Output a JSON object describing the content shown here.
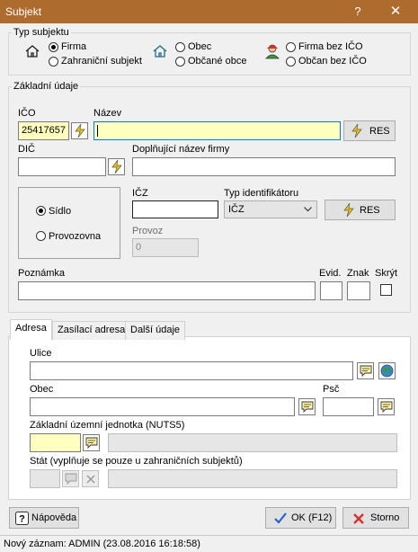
{
  "window": {
    "title": "Subjekt",
    "help": "?",
    "close": "✕"
  },
  "typ_subjektu": {
    "label": "Typ subjektu",
    "options": [
      {
        "label": "Firma",
        "selected": true
      },
      {
        "label": "Zahraniční subjekt",
        "selected": false
      },
      {
        "label": "Obec",
        "selected": false
      },
      {
        "label": "Občané obce",
        "selected": false
      },
      {
        "label": "Firma bez IČO",
        "selected": false
      },
      {
        "label": "Občan bez IČO",
        "selected": false
      }
    ]
  },
  "zakladni": {
    "label": "Základní údaje",
    "ico_label": "IČO",
    "ico_value": "25417657",
    "nazev_label": "Název",
    "nazev_value": "",
    "res_label": "RES",
    "dic_label": "DIČ",
    "dic_value": "",
    "doplnujici_label": "Doplňující název firmy",
    "doplnujici_value": ""
  },
  "provozovna": {
    "sidlo": "Sídlo",
    "provozovna": "Provozovna",
    "selected": "Sídlo",
    "icz_label": "IČZ",
    "icz_value": "",
    "typ_label": "Typ identifikátoru",
    "typ_value": "IČZ",
    "res_label": "RES",
    "provoz_label": "Provoz",
    "provoz_value": "0"
  },
  "poznamka": {
    "label": "Poznámka",
    "value": "",
    "evid_label": "Evid.",
    "znak_label": "Znak",
    "skryt_label": "Skrýt"
  },
  "tabs": [
    {
      "label": "Adresa",
      "active": true
    },
    {
      "label": "Zasílací adresa",
      "active": false
    },
    {
      "label": "Další údaje",
      "active": false
    }
  ],
  "adresa": {
    "ulice_label": "Ulice",
    "ulice_value": "",
    "obec_label": "Obec",
    "obec_value": "",
    "psc_label": "Psč",
    "psc_value": "",
    "nuts_label": "Základní územní jednotka (NUTS5)",
    "nuts_value": "",
    "stat_label": "Stát (vyplňuje se pouze u zahraničních subjektů)",
    "stat_value": ""
  },
  "buttons": {
    "help": "Nápověda",
    "ok": "OK (F12)",
    "cancel": "Storno"
  },
  "status": {
    "text": "Nový záznam: ADMIN (23.08.2016 16:18:58)"
  },
  "colors": {
    "titlebar": "#ad6c2e",
    "lightning": "#f5c400",
    "ok_check": "#2a62c9",
    "cancel_x": "#d83030"
  }
}
